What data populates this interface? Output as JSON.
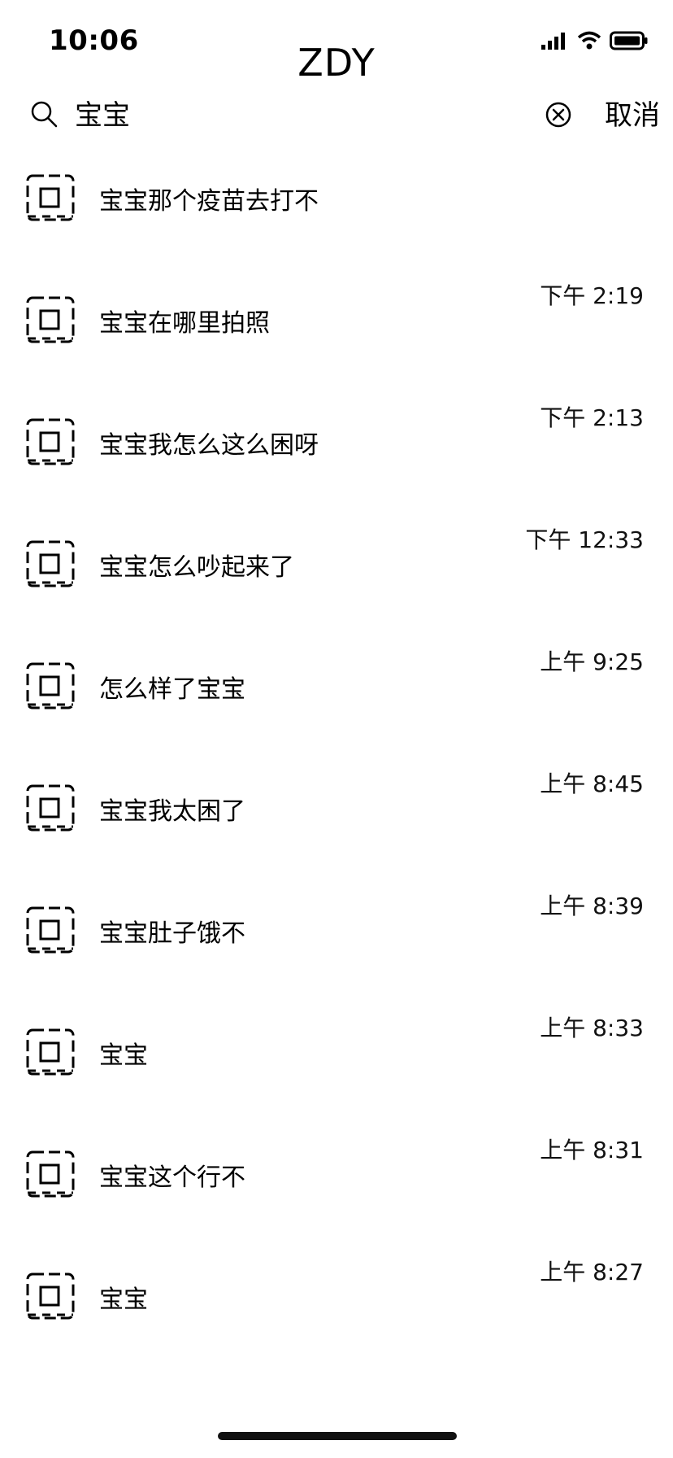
{
  "status_bar": {
    "time": "10:06",
    "icons": [
      "signal-icon",
      "wifi-icon",
      "battery-icon"
    ]
  },
  "header": {
    "title": "ZDY"
  },
  "search": {
    "query": "宝宝",
    "placeholder": "",
    "cancel_label": "取消"
  },
  "results": [
    {
      "text": "宝宝那个疫苗去打不",
      "time": ""
    },
    {
      "text": "宝宝在哪里拍照",
      "time": "下午 2:19"
    },
    {
      "text": "宝宝我怎么这么困呀",
      "time": "下午 2:13"
    },
    {
      "text": "宝宝怎么吵起来了",
      "time": "下午 12:33"
    },
    {
      "text": "怎么样了宝宝",
      "time": "上午 9:25"
    },
    {
      "text": "宝宝我太困了",
      "time": "上午 8:45"
    },
    {
      "text": "宝宝肚子饿不",
      "time": "上午 8:39"
    },
    {
      "text": "宝宝",
      "time": "上午 8:33"
    },
    {
      "text": "宝宝这个行不",
      "time": "上午 8:31"
    },
    {
      "text": "宝宝",
      "time": "上午 8:27"
    }
  ],
  "colors": {
    "background": "#ffffff",
    "text": "#000000",
    "home_indicator": "#111111"
  }
}
